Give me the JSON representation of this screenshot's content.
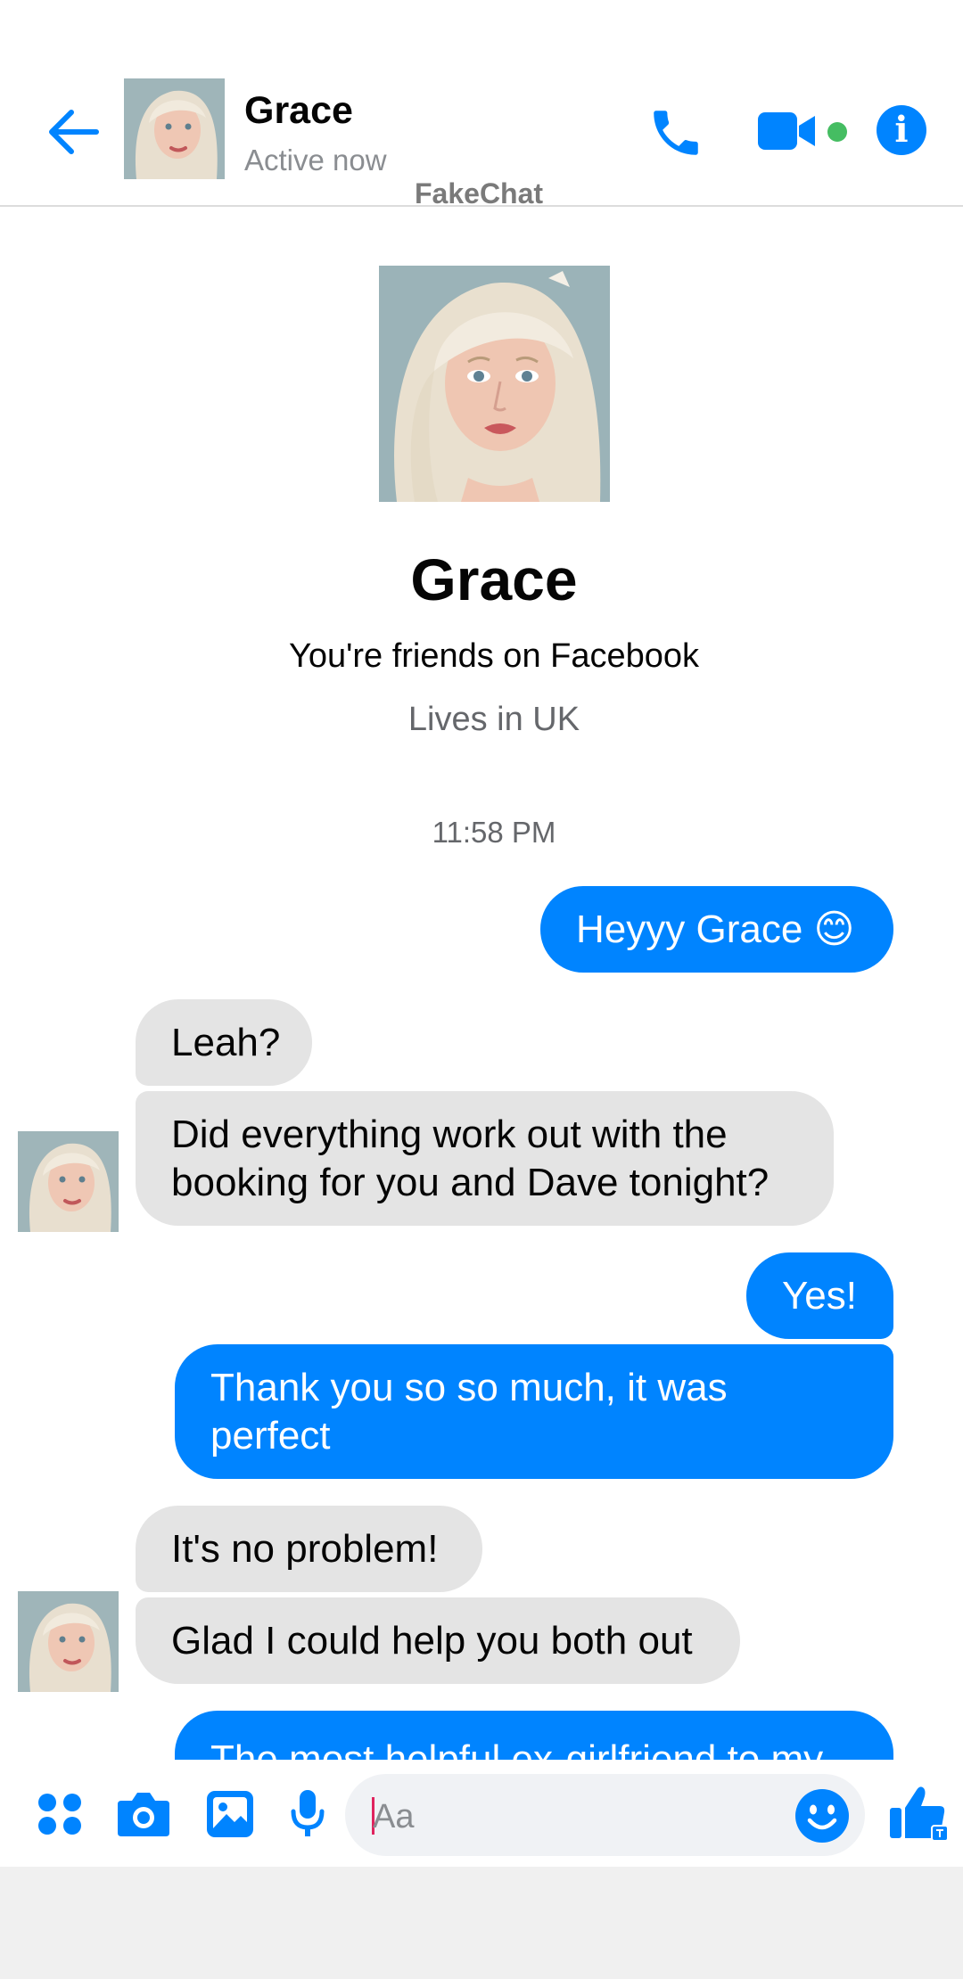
{
  "colors": {
    "accent": "#0084ff",
    "incoming_bubble": "#e4e4e4",
    "online": "#45bd62",
    "secondary_text": "#65676b"
  },
  "header": {
    "contact_name": "Grace",
    "status": "Active now",
    "watermark": "FakeChat",
    "icons": [
      "back-arrow-icon",
      "phone-icon",
      "video-camera-icon",
      "info-icon"
    ]
  },
  "profile": {
    "name": "Grace",
    "friends_text": "You're friends on Facebook",
    "location": "Lives in UK"
  },
  "conversation": {
    "timestamp": "11:58 PM",
    "messages": [
      {
        "from": "me",
        "text": "Heyyy Grace 😊"
      },
      {
        "from": "Grace",
        "text": "Leah?"
      },
      {
        "from": "Grace",
        "text": "Did everything work out with the booking for you and Dave tonight?"
      },
      {
        "from": "me",
        "text": "Yes!"
      },
      {
        "from": "me",
        "text": "Thank you so so much, it was perfect"
      },
      {
        "from": "Grace",
        "text": "It's no problem!"
      },
      {
        "from": "Grace",
        "text": "Glad I could help you both out"
      },
      {
        "from": "me",
        "text": "The most helpful ex-girlfriend to my"
      }
    ]
  },
  "composer": {
    "placeholder": "Aa",
    "icons": [
      "apps-grid-icon",
      "camera-icon",
      "gallery-icon",
      "microphone-icon",
      "emoji-icon",
      "thumbs-up-icon"
    ]
  }
}
